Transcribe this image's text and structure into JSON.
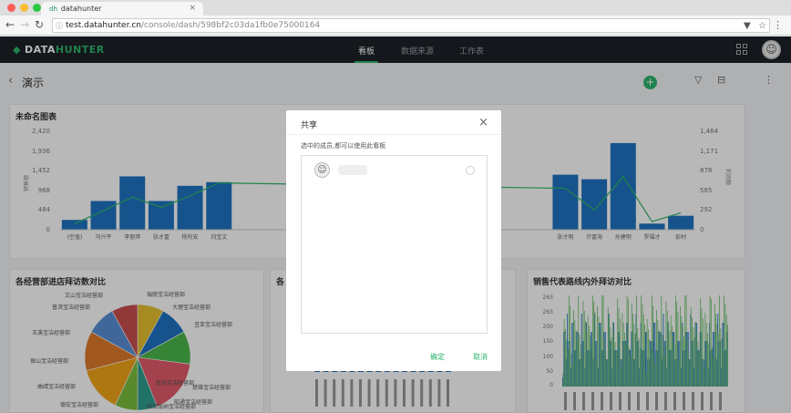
{
  "browser": {
    "tab_title": "datahunter",
    "favicon": "dh",
    "url_host": "test.datahunter.cn",
    "url_path": "/console/dash/598bf2c03da1fb0e75000164"
  },
  "header": {
    "logo_prefix": "DATA",
    "logo_suffix": "HUNTER",
    "nav": [
      "看板",
      "数据来源",
      "工作表"
    ],
    "active_index": 0
  },
  "page": {
    "title": "演示"
  },
  "colors": {
    "accent": "#2db56a",
    "bar": "#1f74c2",
    "line": "#2db56a",
    "header_bg": "#1d2127"
  },
  "charts": {
    "bar_card": {
      "title": "未命名图表",
      "left_axis_ticks": [
        "2,420",
        "1,936",
        "1,452",
        "968",
        "484",
        "0"
      ],
      "right_axis_ticks": [
        "1,464",
        "1,171",
        "878",
        "585",
        "292",
        "0"
      ],
      "left_axis_label": "销售额",
      "right_axis_label": "利润额"
    },
    "pie_card": {
      "title": "各经营部进店拜访数对比"
    },
    "middle_card": {
      "title": "各"
    },
    "right_card": {
      "title": "销售代表路线内外拜访对比",
      "y_ticks": [
        "263",
        "263",
        "200",
        "150",
        "100",
        "50",
        "0"
      ]
    }
  },
  "chart_data": [
    {
      "type": "bar",
      "title": "未命名图表",
      "categories": [
        "(空值)",
        "冯兴平",
        "李丽萍",
        "张才富",
        "杨利安",
        "刘宝文",
        "",
        "",
        "",
        "",
        "",
        "",
        "",
        "",
        "",
        "",
        "",
        "张才明",
        "许富海",
        "孙建明",
        "罗福才",
        "彭村"
      ],
      "series": [
        {
          "type": "bar",
          "values": [
            240,
            700,
            1300,
            700,
            1070,
            1160,
            null,
            null,
            null,
            null,
            null,
            null,
            null,
            null,
            null,
            null,
            null,
            1340,
            1230,
            2110,
            150,
            340
          ]
        },
        {
          "type": "line",
          "values": [
            90,
            280,
            480,
            330,
            500,
            690,
            null,
            null,
            null,
            null,
            null,
            null,
            null,
            null,
            null,
            null,
            null,
            610,
            290,
            780,
            120,
            250
          ]
        }
      ],
      "ylim": [
        0,
        2420
      ],
      "y2lim": [
        0,
        1464
      ]
    },
    {
      "type": "pie",
      "title": "各经营部进店拜访数对比",
      "categories": [
        "文山宝洁经营部",
        "瑞丽宝洁经营部",
        "大理宝洁经营部",
        "丑亚宝洁经营部",
        "楚雄宝洁经营部",
        "昭通宝洁经营部",
        "保山宝洁经营部",
        "曲靖宝洁经营部",
        "玉溪宝洁经营部",
        "普洱宝洁经营部"
      ],
      "values": [
        8,
        9,
        10,
        17,
        6,
        7,
        14,
        12,
        9,
        8
      ]
    }
  ],
  "pie_labels": [
    "文山宝洁经营部",
    "瑞丽宝洁经营部",
    "大理宝洁经营部",
    "普洱宝洁经营部",
    "丑亚宝洁经营部",
    "玉溪宝洁经营部",
    "保山宝洁经营部",
    "楚雄宝洁经营部",
    "曲靖宝洁经营部",
    "昭通宝洁经营部",
    "临沧宝洁经营部",
    "德宏宝洁经营部",
    "西双版纳宝洁经营部"
  ],
  "modal": {
    "title": "共享",
    "hint": "选中的成员,都可以使用此看板",
    "ok_label": "确定",
    "cancel_label": "取消"
  }
}
